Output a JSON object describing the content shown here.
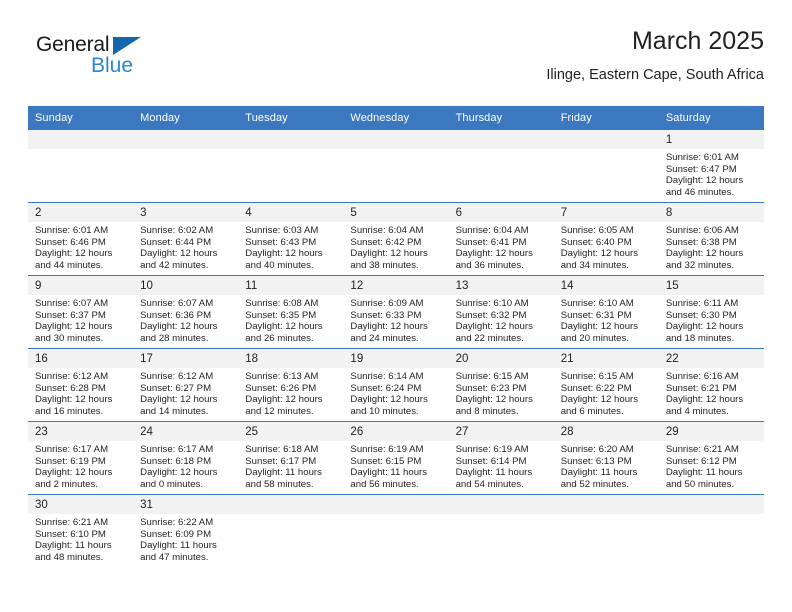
{
  "brand": {
    "name_top": "General",
    "name_bottom": "Blue",
    "accent_color": "#2a87d0",
    "triangle_color": "#1566ad"
  },
  "header": {
    "title": "March 2025",
    "subtitle": "Ilinge, Eastern Cape, South Africa"
  },
  "theme": {
    "header_blue": "#3b78bf",
    "daynum_band": "#f2f2f2",
    "text": "#231f20"
  },
  "calendar": {
    "weekday_headers": [
      "Sunday",
      "Monday",
      "Tuesday",
      "Wednesday",
      "Thursday",
      "Friday",
      "Saturday"
    ],
    "weeks": [
      [
        {
          "day": "",
          "empty": true
        },
        {
          "day": "",
          "empty": true
        },
        {
          "day": "",
          "empty": true
        },
        {
          "day": "",
          "empty": true
        },
        {
          "day": "",
          "empty": true
        },
        {
          "day": "",
          "empty": true
        },
        {
          "day": "1",
          "sunrise": "Sunrise: 6:01 AM",
          "sunset": "Sunset: 6:47 PM",
          "daylight1": "Daylight: 12 hours",
          "daylight2": "and 46 minutes."
        }
      ],
      [
        {
          "day": "2",
          "sunrise": "Sunrise: 6:01 AM",
          "sunset": "Sunset: 6:46 PM",
          "daylight1": "Daylight: 12 hours",
          "daylight2": "and 44 minutes."
        },
        {
          "day": "3",
          "sunrise": "Sunrise: 6:02 AM",
          "sunset": "Sunset: 6:44 PM",
          "daylight1": "Daylight: 12 hours",
          "daylight2": "and 42 minutes."
        },
        {
          "day": "4",
          "sunrise": "Sunrise: 6:03 AM",
          "sunset": "Sunset: 6:43 PM",
          "daylight1": "Daylight: 12 hours",
          "daylight2": "and 40 minutes."
        },
        {
          "day": "5",
          "sunrise": "Sunrise: 6:04 AM",
          "sunset": "Sunset: 6:42 PM",
          "daylight1": "Daylight: 12 hours",
          "daylight2": "and 38 minutes."
        },
        {
          "day": "6",
          "sunrise": "Sunrise: 6:04 AM",
          "sunset": "Sunset: 6:41 PM",
          "daylight1": "Daylight: 12 hours",
          "daylight2": "and 36 minutes."
        },
        {
          "day": "7",
          "sunrise": "Sunrise: 6:05 AM",
          "sunset": "Sunset: 6:40 PM",
          "daylight1": "Daylight: 12 hours",
          "daylight2": "and 34 minutes."
        },
        {
          "day": "8",
          "sunrise": "Sunrise: 6:06 AM",
          "sunset": "Sunset: 6:38 PM",
          "daylight1": "Daylight: 12 hours",
          "daylight2": "and 32 minutes."
        }
      ],
      [
        {
          "day": "9",
          "sunrise": "Sunrise: 6:07 AM",
          "sunset": "Sunset: 6:37 PM",
          "daylight1": "Daylight: 12 hours",
          "daylight2": "and 30 minutes."
        },
        {
          "day": "10",
          "sunrise": "Sunrise: 6:07 AM",
          "sunset": "Sunset: 6:36 PM",
          "daylight1": "Daylight: 12 hours",
          "daylight2": "and 28 minutes."
        },
        {
          "day": "11",
          "sunrise": "Sunrise: 6:08 AM",
          "sunset": "Sunset: 6:35 PM",
          "daylight1": "Daylight: 12 hours",
          "daylight2": "and 26 minutes."
        },
        {
          "day": "12",
          "sunrise": "Sunrise: 6:09 AM",
          "sunset": "Sunset: 6:33 PM",
          "daylight1": "Daylight: 12 hours",
          "daylight2": "and 24 minutes."
        },
        {
          "day": "13",
          "sunrise": "Sunrise: 6:10 AM",
          "sunset": "Sunset: 6:32 PM",
          "daylight1": "Daylight: 12 hours",
          "daylight2": "and 22 minutes."
        },
        {
          "day": "14",
          "sunrise": "Sunrise: 6:10 AM",
          "sunset": "Sunset: 6:31 PM",
          "daylight1": "Daylight: 12 hours",
          "daylight2": "and 20 minutes."
        },
        {
          "day": "15",
          "sunrise": "Sunrise: 6:11 AM",
          "sunset": "Sunset: 6:30 PM",
          "daylight1": "Daylight: 12 hours",
          "daylight2": "and 18 minutes."
        }
      ],
      [
        {
          "day": "16",
          "sunrise": "Sunrise: 6:12 AM",
          "sunset": "Sunset: 6:28 PM",
          "daylight1": "Daylight: 12 hours",
          "daylight2": "and 16 minutes."
        },
        {
          "day": "17",
          "sunrise": "Sunrise: 6:12 AM",
          "sunset": "Sunset: 6:27 PM",
          "daylight1": "Daylight: 12 hours",
          "daylight2": "and 14 minutes."
        },
        {
          "day": "18",
          "sunrise": "Sunrise: 6:13 AM",
          "sunset": "Sunset: 6:26 PM",
          "daylight1": "Daylight: 12 hours",
          "daylight2": "and 12 minutes."
        },
        {
          "day": "19",
          "sunrise": "Sunrise: 6:14 AM",
          "sunset": "Sunset: 6:24 PM",
          "daylight1": "Daylight: 12 hours",
          "daylight2": "and 10 minutes."
        },
        {
          "day": "20",
          "sunrise": "Sunrise: 6:15 AM",
          "sunset": "Sunset: 6:23 PM",
          "daylight1": "Daylight: 12 hours",
          "daylight2": "and 8 minutes."
        },
        {
          "day": "21",
          "sunrise": "Sunrise: 6:15 AM",
          "sunset": "Sunset: 6:22 PM",
          "daylight1": "Daylight: 12 hours",
          "daylight2": "and 6 minutes."
        },
        {
          "day": "22",
          "sunrise": "Sunrise: 6:16 AM",
          "sunset": "Sunset: 6:21 PM",
          "daylight1": "Daylight: 12 hours",
          "daylight2": "and 4 minutes."
        }
      ],
      [
        {
          "day": "23",
          "sunrise": "Sunrise: 6:17 AM",
          "sunset": "Sunset: 6:19 PM",
          "daylight1": "Daylight: 12 hours",
          "daylight2": "and 2 minutes."
        },
        {
          "day": "24",
          "sunrise": "Sunrise: 6:17 AM",
          "sunset": "Sunset: 6:18 PM",
          "daylight1": "Daylight: 12 hours",
          "daylight2": "and 0 minutes."
        },
        {
          "day": "25",
          "sunrise": "Sunrise: 6:18 AM",
          "sunset": "Sunset: 6:17 PM",
          "daylight1": "Daylight: 11 hours",
          "daylight2": "and 58 minutes."
        },
        {
          "day": "26",
          "sunrise": "Sunrise: 6:19 AM",
          "sunset": "Sunset: 6:15 PM",
          "daylight1": "Daylight: 11 hours",
          "daylight2": "and 56 minutes."
        },
        {
          "day": "27",
          "sunrise": "Sunrise: 6:19 AM",
          "sunset": "Sunset: 6:14 PM",
          "daylight1": "Daylight: 11 hours",
          "daylight2": "and 54 minutes."
        },
        {
          "day": "28",
          "sunrise": "Sunrise: 6:20 AM",
          "sunset": "Sunset: 6:13 PM",
          "daylight1": "Daylight: 11 hours",
          "daylight2": "and 52 minutes."
        },
        {
          "day": "29",
          "sunrise": "Sunrise: 6:21 AM",
          "sunset": "Sunset: 6:12 PM",
          "daylight1": "Daylight: 11 hours",
          "daylight2": "and 50 minutes."
        }
      ],
      [
        {
          "day": "30",
          "sunrise": "Sunrise: 6:21 AM",
          "sunset": "Sunset: 6:10 PM",
          "daylight1": "Daylight: 11 hours",
          "daylight2": "and 48 minutes."
        },
        {
          "day": "31",
          "sunrise": "Sunrise: 6:22 AM",
          "sunset": "Sunset: 6:09 PM",
          "daylight1": "Daylight: 11 hours",
          "daylight2": "and 47 minutes."
        },
        {
          "day": "",
          "empty": true
        },
        {
          "day": "",
          "empty": true
        },
        {
          "day": "",
          "empty": true
        },
        {
          "day": "",
          "empty": true
        },
        {
          "day": "",
          "empty": true
        }
      ]
    ]
  }
}
